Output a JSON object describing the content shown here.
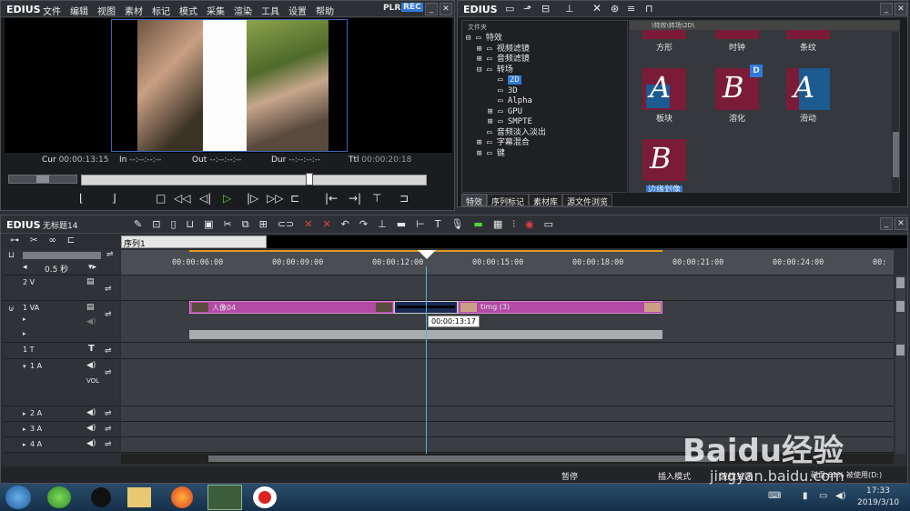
{
  "app": {
    "name": "EDIUS",
    "title": "无标题14"
  },
  "menu": [
    "文件",
    "编辑",
    "视图",
    "素材",
    "标记",
    "模式",
    "采集",
    "渲染",
    "工具",
    "设置",
    "帮助"
  ],
  "player": {
    "plr": "PLR",
    "rec": "REC",
    "cur_label": "Cur",
    "cur_value": "00:00:13:15",
    "in_label": "In",
    "in_value": "--:--:--:--",
    "out_label": "Out",
    "out_value": "--:--:--:--",
    "dur_label": "Dur",
    "dur_value": "--:--:--:--",
    "ttl_label": "Ttl",
    "ttl_value": "00:00:20:18"
  },
  "effects": {
    "logo": "EDIUS",
    "folder_header": "文件夹",
    "path": "\\特效\\转场\\2D\\",
    "tree": [
      {
        "label": "特效",
        "indent": 0,
        "expand": "⊟"
      },
      {
        "label": "视频滤镜",
        "indent": 1,
        "expand": "⊞"
      },
      {
        "label": "音频滤镜",
        "indent": 1,
        "expand": "⊞"
      },
      {
        "label": "转场",
        "indent": 1,
        "expand": "⊟"
      },
      {
        "label": "2D",
        "indent": 2,
        "expand": "",
        "selected": true
      },
      {
        "label": "3D",
        "indent": 2,
        "expand": ""
      },
      {
        "label": "Alpha",
        "indent": 2,
        "expand": ""
      },
      {
        "label": "GPU",
        "indent": 2,
        "expand": "⊞"
      },
      {
        "label": "SMPTE",
        "indent": 2,
        "expand": "⊞"
      },
      {
        "label": "音频淡入淡出",
        "indent": 1,
        "expand": ""
      },
      {
        "label": "字幕混合",
        "indent": 1,
        "expand": "⊞"
      },
      {
        "label": "键",
        "indent": 1,
        "expand": "⊞"
      }
    ],
    "tiles_top": [
      "方形",
      "时钟",
      "条纹"
    ],
    "tiles": [
      {
        "label": "板块",
        "letter": "A"
      },
      {
        "label": "溶化",
        "letter": "B"
      },
      {
        "label": "滑动",
        "letter": "A"
      },
      {
        "label": "边缘划像",
        "letter": "B",
        "selected": true
      }
    ],
    "tabs": [
      "特效",
      "序列标记",
      "素材库",
      "源文件浏览"
    ]
  },
  "timeline": {
    "logo": "EDIUS",
    "title": "无标题14",
    "sequence_tab": "序列1",
    "zoom": "0.5 秒",
    "ruler": [
      "00:00:06:00",
      "00:00:09:00",
      "00:00:12:00",
      "00:00:15:00",
      "00:00:18:00",
      "00:00:21:00",
      "00:00:24:00",
      "00:"
    ],
    "tracks": [
      {
        "name": "2 V"
      },
      {
        "name": "1 VA"
      },
      {
        "name": "1 T"
      },
      {
        "name": "1 A",
        "vol": "VOL"
      },
      {
        "name": "2 A"
      },
      {
        "name": "3 A"
      },
      {
        "name": "4 A"
      }
    ],
    "clip1": "人像04",
    "clip2": "timg (3)",
    "tooltip": "00:00:13:17"
  },
  "statusbar": {
    "pause": "暂停",
    "insert_mode": "插入模式",
    "ripple": "波纹关闭",
    "disk": "磁盘:61% 被使用(D:)"
  },
  "taskbar": {
    "time": "17:33",
    "date": "2019/3/10"
  },
  "watermark": {
    "brand": "Baidu经验",
    "url": "jingyan.baidu.com"
  },
  "colors": {
    "accent": "#2f7ad8",
    "clip": "#b24aa6",
    "tile": "#7a1c38",
    "play": "#53d63a"
  }
}
